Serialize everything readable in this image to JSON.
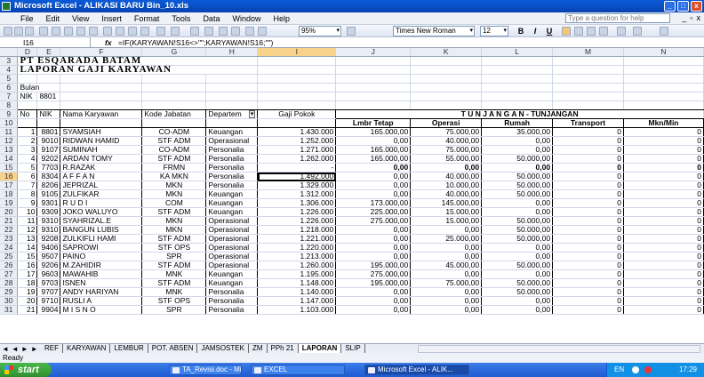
{
  "window": {
    "title": "Microsoft Excel - ALIKASI BARU Bin_10.xls",
    "min": "_",
    "max": "□",
    "close": "x"
  },
  "menu": {
    "items": [
      "File",
      "Edit",
      "View",
      "Insert",
      "Format",
      "Tools",
      "Data",
      "Window",
      "Help"
    ],
    "help_placeholder": "Type a question for help"
  },
  "toolbar": {
    "zoom": "95%",
    "font": "Times New Roman",
    "size": "12",
    "bold": "B",
    "italic": "I",
    "underline": "U"
  },
  "formula": {
    "name_box": "I16",
    "fx": "fx",
    "content": "=IF(KARYAWAN!S16<>\"\";KARYAWAN!S16;\"\")"
  },
  "columns": [
    "D",
    "E",
    "F",
    "G",
    "H",
    "I",
    "J",
    "K",
    "L",
    "M",
    "N"
  ],
  "selected_column": "I",
  "selected_row": "16",
  "header": {
    "company": "PT ESQARADA BATAM",
    "report": "LAPORAN GAJI KARYAWAN",
    "bulan": "Bulan",
    "nik": "NIK",
    "nik_value": "8801"
  },
  "table_head": {
    "no": "No",
    "nik": "NIK",
    "nama": "Nama Karyawan",
    "kode": "Kode Jabatan",
    "dept": "Departem",
    "filter": "▾",
    "gaji": "Gaji Pokok",
    "tunjangan": "T U N J A N G A N - TUNJANGAN",
    "lembur": "Lmbr Tetap",
    "operasi": "Operasi",
    "rumah": "Rumah",
    "transport": "Transport",
    "makan": "Mkn/Min"
  },
  "rows": [
    {
      "r": "11",
      "no": "1",
      "nik": "8801",
      "nama": "SYAMSIAH",
      "kode": "CO-ADM",
      "dept": "Keuangan",
      "gaji": "1.430.000",
      "lembur": "165.000,00",
      "operasi": "75.000,00",
      "rumah": "35.000,00",
      "transport": "0",
      "makan": "0"
    },
    {
      "r": "12",
      "no": "2",
      "nik": "9010",
      "nama": "RIDWAN  HAMID",
      "kode": "STF ADM",
      "dept": "Operasional",
      "gaji": "1.252.000",
      "lembur": "0,00",
      "operasi": "40.000,00",
      "rumah": "0,00",
      "transport": "0",
      "makan": "0"
    },
    {
      "r": "13",
      "no": "3",
      "nik": "9107",
      "nama": "SUMINAH",
      "kode": "CO-ADM",
      "dept": "Personalia",
      "gaji": "1.271.000",
      "lembur": "165.000,00",
      "operasi": "75.000,00",
      "rumah": "0,00",
      "transport": "0",
      "makan": "0"
    },
    {
      "r": "14",
      "no": "4",
      "nik": "9202",
      "nama": "ARDAN  TOMY",
      "kode": "STF ADM",
      "dept": "Personalia",
      "gaji": "1.262.000",
      "lembur": "165.000,00",
      "operasi": "55.000,00",
      "rumah": "50.000,00",
      "transport": "0",
      "makan": "0"
    },
    {
      "r": "15",
      "no": "5",
      "nik": "7703",
      "nama": "R.RAZAK",
      "kode": "FRMN",
      "dept": "Personalia",
      "gaji": "-",
      "lembur": "0,00",
      "operasi": "0,00",
      "rumah": "0,00",
      "transport": "0",
      "makan": "0",
      "bold": true
    },
    {
      "r": "16",
      "no": "6",
      "nik": "8304",
      "nama": "A F F A N",
      "kode": "KA MKN",
      "dept": "Personalia",
      "gaji": "1.492.000",
      "lembur": "0,00",
      "operasi": "40.000,00",
      "rumah": "50.000,00",
      "transport": "0",
      "makan": "0",
      "active": true
    },
    {
      "r": "17",
      "no": "7",
      "nik": "8206",
      "nama": "JEPRIZAL",
      "kode": "MKN",
      "dept": "Personalia",
      "gaji": "1.329.000",
      "lembur": "0,00",
      "operasi": "10.000,00",
      "rumah": "50.000,00",
      "transport": "0",
      "makan": "0"
    },
    {
      "r": "18",
      "no": "8",
      "nik": "9105",
      "nama": "ZULFIKAR",
      "kode": "MKN",
      "dept": "Keuangan",
      "gaji": "1.312.000",
      "lembur": "0,00",
      "operasi": "40.000,00",
      "rumah": "50.000,00",
      "transport": "0",
      "makan": "0"
    },
    {
      "r": "19",
      "no": "9",
      "nik": "9301",
      "nama": "R U D I",
      "kode": "COM",
      "dept": "Keuangan",
      "gaji": "1.306.000",
      "lembur": "173.000,00",
      "operasi": "145.000,00",
      "rumah": "0,00",
      "transport": "0",
      "makan": "0"
    },
    {
      "r": "20",
      "no": "10",
      "nik": "9309",
      "nama": "JOKO  WALUYO",
      "kode": "STF ADM",
      "dept": "Keuangan",
      "gaji": "1.226.000",
      "lembur": "225.000,00",
      "operasi": "15.000,00",
      "rumah": "0,00",
      "transport": "0",
      "makan": "0"
    },
    {
      "r": "21",
      "no": "11",
      "nik": "9310",
      "nama": "SYAHRIZAL.E",
      "kode": "MKN",
      "dept": "Operasional",
      "gaji": "1.226.000",
      "lembur": "275.000,00",
      "operasi": "15.000,00",
      "rumah": "50.000,00",
      "transport": "0",
      "makan": "0"
    },
    {
      "r": "22",
      "no": "12",
      "nik": "9310",
      "nama": "BANGUN  LUBIS",
      "kode": "MKN",
      "dept": "Operasional",
      "gaji": "1.218.000",
      "lembur": "0,00",
      "operasi": "0,00",
      "rumah": "50.000,00",
      "transport": "0",
      "makan": "0"
    },
    {
      "r": "23",
      "no": "13",
      "nik": "9208",
      "nama": "ZULKIFLI  HAMI",
      "kode": "STF ADM",
      "dept": "Operasional",
      "gaji": "1.221.000",
      "lembur": "0,00",
      "operasi": "25.000,00",
      "rumah": "50.000,00",
      "transport": "0",
      "makan": "0"
    },
    {
      "r": "24",
      "no": "14",
      "nik": "9406",
      "nama": "SAPROWI",
      "kode": "STF OPS",
      "dept": "Operasional",
      "gaji": "1.220.000",
      "lembur": "0,00",
      "operasi": "0,00",
      "rumah": "0,00",
      "transport": "0",
      "makan": "0"
    },
    {
      "r": "25",
      "no": "15",
      "nik": "9507",
      "nama": "PAINO",
      "kode": "SPR",
      "dept": "Operasional",
      "gaji": "1.213.000",
      "lembur": "0,00",
      "operasi": "0,00",
      "rumah": "0,00",
      "transport": "0",
      "makan": "0"
    },
    {
      "r": "26",
      "no": "16",
      "nik": "9206",
      "nama": "M.ZAHIDIR",
      "kode": "STF ADM",
      "dept": "Operasional",
      "gaji": "1.260.000",
      "lembur": "195.000,00",
      "operasi": "45.000,00",
      "rumah": "50.000,00",
      "transport": "0",
      "makan": "0"
    },
    {
      "r": "27",
      "no": "17",
      "nik": "9603",
      "nama": "MAWAHIB",
      "kode": "MNK",
      "dept": "Keuangan",
      "gaji": "1.195.000",
      "lembur": "275.000,00",
      "operasi": "0,00",
      "rumah": "0,00",
      "transport": "0",
      "makan": "0"
    },
    {
      "r": "28",
      "no": "18",
      "nik": "9703",
      "nama": "ISNEN",
      "kode": "STF ADM",
      "dept": "Keuangan",
      "gaji": "1.148.000",
      "lembur": "195.000,00",
      "operasi": "75.000,00",
      "rumah": "50.000,00",
      "transport": "0",
      "makan": "0"
    },
    {
      "r": "29",
      "no": "19",
      "nik": "9707",
      "nama": "ANDY HARIYAN",
      "kode": "MNK",
      "dept": "Personalia",
      "gaji": "1.140.000",
      "lembur": "0,00",
      "operasi": "0,00",
      "rumah": "50.000,00",
      "transport": "0",
      "makan": "0"
    },
    {
      "r": "30",
      "no": "20",
      "nik": "9710",
      "nama": "RUSLI  A",
      "kode": "STF OPS",
      "dept": "Personalia",
      "gaji": "1.147.000",
      "lembur": "0,00",
      "operasi": "0,00",
      "rumah": "0,00",
      "transport": "0",
      "makan": "0"
    },
    {
      "r": "31",
      "no": "21",
      "nik": "9904",
      "nama": "M I S N O",
      "kode": "SPR",
      "dept": "Personalia",
      "gaji": "1.103.000",
      "lembur": "0,00",
      "operasi": "0,00",
      "rumah": "0,00",
      "transport": "0",
      "makan": "0"
    }
  ],
  "sheet_tabs": [
    "REF",
    "KARYAWAN",
    "LEMBUR",
    "POT. ABSEN",
    "JAMSOSTEK",
    "ZM",
    "PPh 21",
    "LAPORAN",
    "SLIP"
  ],
  "active_tab": "LAPORAN",
  "status": "Ready",
  "taskbar": {
    "start": "start",
    "tasks": [
      "TA_Revisi.doc - Micro...",
      "EXCEL",
      "Microsoft Excel - ALIK..."
    ],
    "lang": "EN",
    "time": "17:29"
  }
}
